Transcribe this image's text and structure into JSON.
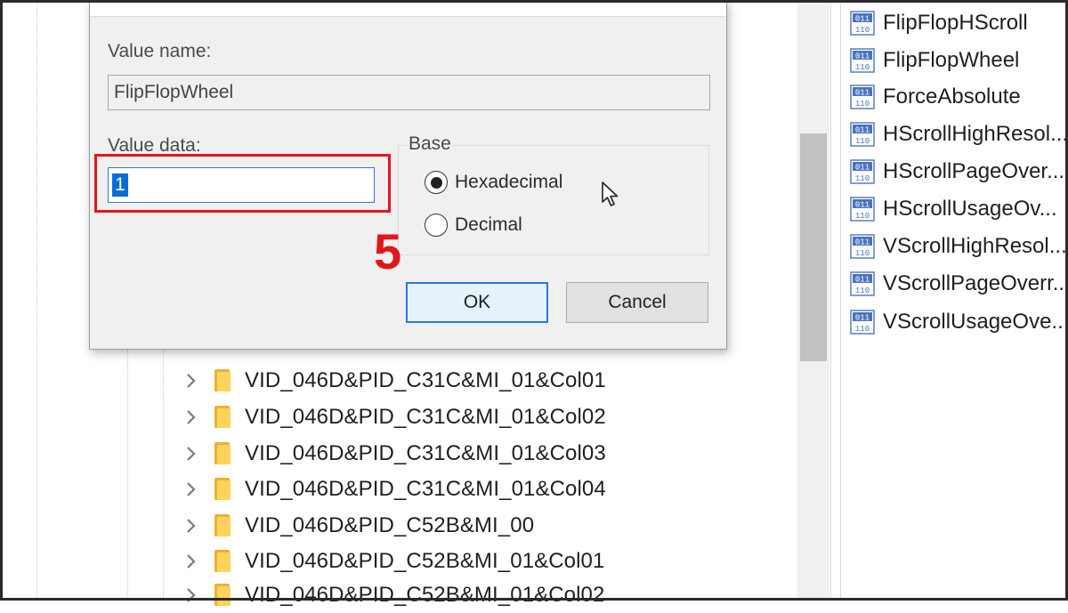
{
  "dialog": {
    "value_name_label": "Value name:",
    "value_name": "FlipFlopWheel",
    "value_data_label": "Value data:",
    "value_data": "1",
    "base_label": "Base",
    "base_options": [
      {
        "label": "Hexadecimal",
        "checked": true
      },
      {
        "label": "Decimal",
        "checked": false
      }
    ],
    "ok_label": "OK",
    "cancel_label": "Cancel"
  },
  "annotation": {
    "step": "5",
    "color": "#e3161b"
  },
  "tree": {
    "items": [
      "VID_046D&PID_C31C&MI_01&Col01",
      "VID_046D&PID_C31C&MI_01&Col02",
      "VID_046D&PID_C31C&MI_01&Col03",
      "VID_046D&PID_C31C&MI_01&Col04",
      "VID_046D&PID_C52B&MI_00",
      "VID_046D&PID_C52B&MI_01&Col01",
      "VID_046D&PID_C52B&MI_01&Col02"
    ]
  },
  "values": {
    "items": [
      "FlipFlopHScroll",
      "FlipFlopWheel",
      "ForceAbsolute",
      "HScrollHighResol...",
      "HScrollPageOver...",
      "HScrollUsageOv...",
      "VScrollHighResol...",
      "VScrollPageOverr...",
      "VScrollUsageOve..."
    ],
    "icon": "reg-dword-icon"
  },
  "colors": {
    "accent": "#0a6cd6",
    "highlight": "#e3161b",
    "dialog_bg": "#f0f0f0"
  }
}
